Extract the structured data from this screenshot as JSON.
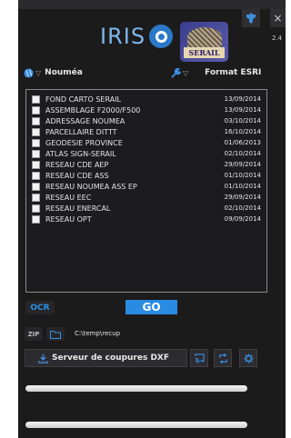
{
  "app": {
    "logo_text": "IRIS",
    "badge_text": "SERAIL",
    "version": "2.4"
  },
  "window": {
    "close_label": "×"
  },
  "location": {
    "label": "Nouméa"
  },
  "format": {
    "label": "Format ESRI"
  },
  "layers": [
    {
      "name": "FOND CARTO SERAIL",
      "date": "13/09/2014"
    },
    {
      "name": "ASSEMBLAGE F2000/F500",
      "date": "13/09/2014"
    },
    {
      "name": "ADRESSAGE NOUMEA",
      "date": "03/10/2014"
    },
    {
      "name": "PARCELLAIRE DITTT",
      "date": "16/10/2014"
    },
    {
      "name": "GEODESIE PROVINCE",
      "date": "01/06/2013"
    },
    {
      "name": "ATLAS SIGN-SERAIL",
      "date": "02/10/2014"
    },
    {
      "name": "RESEAU CDE AEP",
      "date": "29/09/2014"
    },
    {
      "name": "RESEAU CDE ASS",
      "date": "01/10/2014"
    },
    {
      "name": "RESEAU NOUMEA ASS EP",
      "date": "01/10/2014"
    },
    {
      "name": "RESEAU EEC",
      "date": "29/09/2014"
    },
    {
      "name": "RESEAU ENERCAL",
      "date": "02/10/2014"
    },
    {
      "name": "RESEAU OPT",
      "date": "09/09/2014"
    }
  ],
  "actions": {
    "ocr_label": "OCR",
    "go_label": "GO",
    "zip_label": "ZIP"
  },
  "output": {
    "path": "C:\\temp\\recup"
  },
  "server": {
    "label": "Serveur de coupures DXF"
  },
  "progress": {
    "bar1": 0,
    "bar2": 0
  },
  "colors": {
    "accent": "#2a8be2",
    "background": "#1b1b1c"
  }
}
